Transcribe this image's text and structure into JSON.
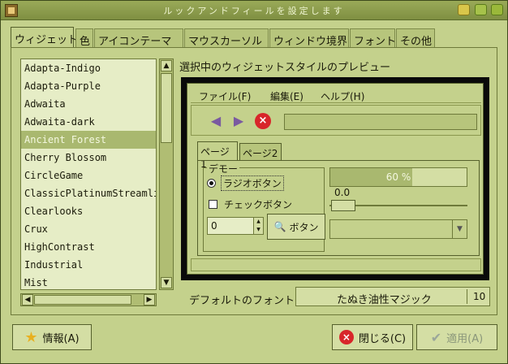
{
  "window": {
    "title": "ルックアンドフィールを設定します"
  },
  "tabs": [
    "ウィジェット",
    "色",
    "アイコンテーマ",
    "マウスカーソル",
    "ウィンドウ境界",
    "フォント",
    "その他"
  ],
  "themes": [
    "Adapta-Indigo",
    "Adapta-Purple",
    "Adwaita",
    "Adwaita-dark",
    "Ancient Forest",
    "Cherry Blossom",
    "CircleGame",
    "ClassicPlatinumStreamlined",
    "Clearlooks",
    "Crux",
    "HighContrast",
    "Industrial",
    "Mist"
  ],
  "selected_theme": "Ancient Forest",
  "preview": {
    "label": "選択中のウィジェットスタイルのプレビュー",
    "menu": [
      "ファイル(F)",
      "編集(E)",
      "ヘルプ(H)"
    ],
    "pages": [
      "ページ1",
      "ページ2"
    ],
    "demo_legend": "デモー",
    "radio_label": "ラジオボタン",
    "check_label": "チェックボタン",
    "spin_value": "0",
    "button_label": "ボタン",
    "progress": {
      "value": 0.6,
      "text": "60 %"
    },
    "scale_value": "0.0"
  },
  "font": {
    "label": "デフォルトのフォント:",
    "name": "たぬき油性マジック",
    "size": "10"
  },
  "buttons": {
    "about": "情報(A)",
    "close": "閉じる(C)",
    "apply": "適用(A)"
  }
}
